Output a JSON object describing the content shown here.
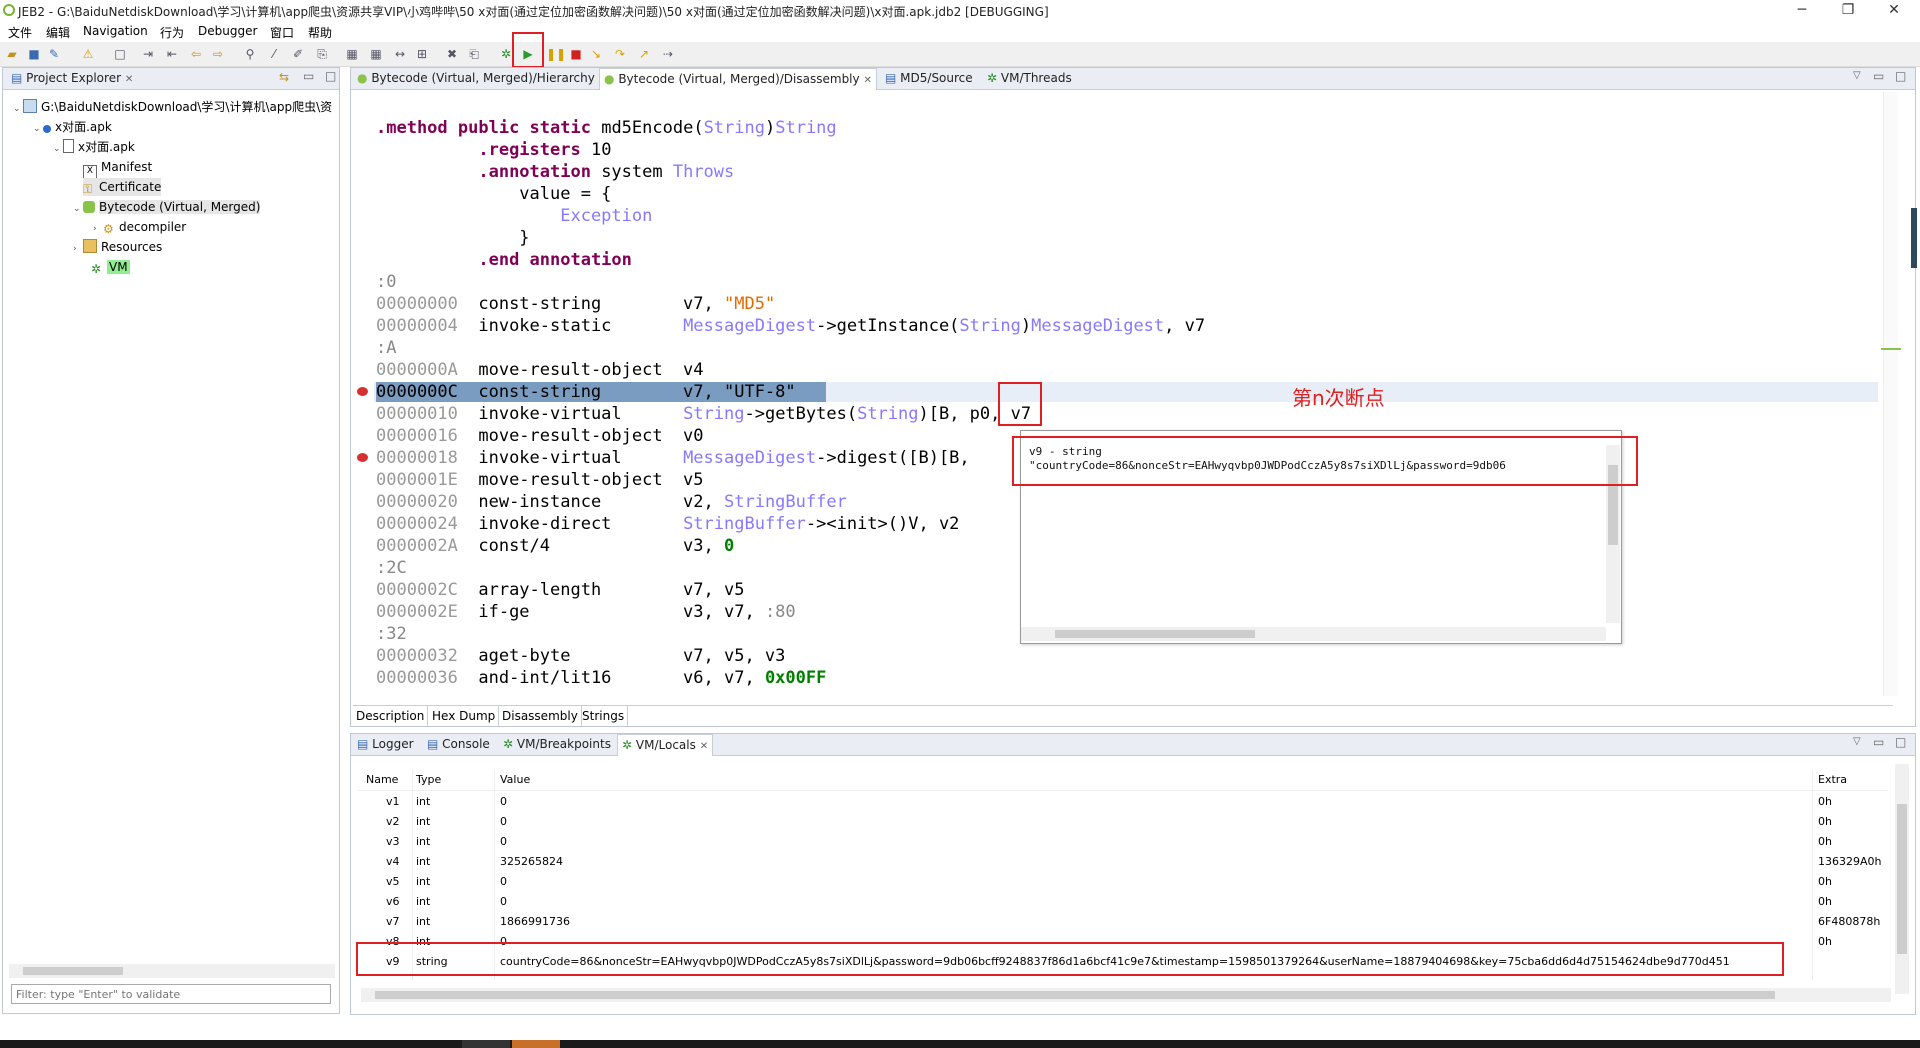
{
  "window": {
    "title": "JEB2 - G:\\BaiduNetdiskDownload\\学习\\计算机\\app爬虫\\资源共享VIP\\小鸡哔哔\\50 x对面(通过定位加密函数解决问题)\\50 x对面(通过定位加密函数解决问题)\\x对面.apk.jdb2 [DEBUGGING]",
    "min": "─",
    "max": "❐",
    "close": "✕"
  },
  "menu": [
    "文件",
    "编辑",
    "Navigation",
    "行为",
    "Debugger",
    "窗口",
    "帮助"
  ],
  "project_explorer": {
    "tab": "Project Explorer",
    "tree": [
      {
        "label": "G:\\BaiduNetdiskDownload\\学习\\计算机\\app爬虫\\资",
        "icon": "project-icon"
      },
      {
        "label": "x对面.apk",
        "icon": "apk-icon"
      },
      {
        "label": "x对面.apk",
        "icon": "apk-file-icon"
      },
      {
        "label": "Manifest",
        "icon": "manifest-icon"
      },
      {
        "label": "Certificate",
        "icon": "key-icon"
      },
      {
        "label": "Bytecode (Virtual, Merged)",
        "icon": "android-icon"
      },
      {
        "label": "decompiler",
        "icon": "gear-icon"
      },
      {
        "label": "Resources",
        "icon": "folder-icon"
      },
      {
        "label": "VM",
        "icon": "bug-icon"
      }
    ],
    "filter_placeholder": "Filter: type \"Enter\" to validate"
  },
  "editor": {
    "tabs": [
      "Bytecode (Virtual, Merged)/Hierarchy",
      "Bytecode (Virtual, Merged)/Disassembly",
      "MD5/Source",
      "VM/Threads"
    ],
    "bottom_tabs": [
      "Description",
      "Hex Dump",
      "Disassembly",
      "Strings"
    ]
  },
  "annotation": "第n次断点",
  "tooltip": {
    "line1": "v9 - string",
    "line2": "\"countryCode=86&nonceStr=EAHwyqvbp0JWDPodCczA5y8s7siXDlLj&password=9db06"
  },
  "locals_panel": {
    "tabs": [
      "Logger",
      "Console",
      "VM/Breakpoints",
      "VM/Locals"
    ],
    "columns": [
      "Name",
      "Type",
      "Value",
      "Extra"
    ],
    "rows": [
      {
        "name": "v1",
        "type": "int",
        "value": "0",
        "extra": "0h"
      },
      {
        "name": "v2",
        "type": "int",
        "value": "0",
        "extra": "0h"
      },
      {
        "name": "v3",
        "type": "int",
        "value": "0",
        "extra": "0h"
      },
      {
        "name": "v4",
        "type": "int",
        "value": "325265824",
        "extra": "136329A0h"
      },
      {
        "name": "v5",
        "type": "int",
        "value": "0",
        "extra": "0h"
      },
      {
        "name": "v6",
        "type": "int",
        "value": "0",
        "extra": "0h"
      },
      {
        "name": "v7",
        "type": "int",
        "value": "1866991736",
        "extra": "6F480878h"
      },
      {
        "name": "v8",
        "type": "int",
        "value": "0",
        "extra": "0h"
      },
      {
        "name": "v9",
        "type": "string",
        "value": "countryCode=86&nonceStr=EAHwyqvbp0JWDPodCczA5y8s7siXDlLj&password=9db06bcff9248837f86d1a6bcf41c9e7&timestamp=1598501379264&userName=18879404698&key=75cba6dd6d4d75154624dbe9d770d451",
        "extra": ""
      }
    ]
  }
}
